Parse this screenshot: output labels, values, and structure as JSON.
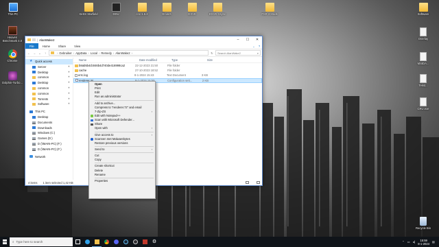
{
  "colors": {
    "accent": "#1979ca",
    "selection": "#cce8ff",
    "taskbar": "#101419",
    "menu_bg": "#f0f0f0"
  },
  "desktop": {
    "top_icons": [
      {
        "label": "This PC",
        "icon": "this-pc-icon"
      },
      {
        "label": "XeSS Starfield",
        "icon": "folder-icon"
      },
      {
        "label": "DDU",
        "icon": "app-icon"
      },
      {
        "label": "cnc-1.5.2",
        "icon": "folder-icon"
      },
      {
        "label": "Drivers",
        "icon": "folder-icon"
      },
      {
        "label": "DXVK",
        "icon": "folder-icon"
      },
      {
        "label": "DXVK-Async",
        "icon": "folder-icon"
      },
      {
        "label": "FSR 3 Mods",
        "icon": "folder-icon"
      },
      {
        "label": "Software",
        "icon": "folder-icon"
      }
    ],
    "left_icons": [
      {
        "label": "Heaven Benchmark 4.0",
        "icon": "game-icon"
      },
      {
        "label": "Chrome",
        "icon": "chrome-icon"
      },
      {
        "label": "Dolphin-Turbo...",
        "icon": "app-icon"
      }
    ],
    "right_icons": [
      {
        "label": "Overlay",
        "icon": "document-icon"
      },
      {
        "label": "MSIDA...",
        "icon": "document-icon"
      },
      {
        "label": "Tekst...",
        "icon": "document-icon"
      },
      {
        "label": "CRU.exe",
        "icon": "document-icon"
      },
      {
        "label": "Recycle Bin",
        "icon": "recycle-bin-icon"
      }
    ]
  },
  "explorer": {
    "title": "AlanWake2",
    "ribbon_tabs": [
      "File",
      "Home",
      "Share",
      "View"
    ],
    "breadcrumb": [
      "Gebruiker",
      "AppData",
      "Local",
      "Remedy",
      "AlanWake2"
    ],
    "search_placeholder": "Search AlanWake2",
    "nav": {
      "quick_access": "Quick access",
      "pinned": [
        "Server",
        "Desktop",
        "common",
        "Desktop",
        "common",
        "common",
        "Torrents",
        "Software"
      ],
      "this_pc": "This PC",
      "pc_items": [
        "Desktop",
        "Documents",
        "Downloads",
        "Windows (C:)",
        "Games (D:)",
        "D (\\\\MAIN-PC) (F:)",
        "D (\\\\MAIN-PC) (F:)"
      ],
      "network": "Network"
    },
    "columns": {
      "name": "Name",
      "date": "Date modified",
      "type": "Type",
      "size": "Size"
    },
    "files": [
      {
        "name": "b8ab5b4cb046b4d740de416998ca2",
        "date": "22-12-2023 21:50",
        "type": "File folder",
        "size": "",
        "icon": "folder"
      },
      {
        "name": "cache",
        "date": "27-10-2023 18:52",
        "type": "File folder",
        "size": "",
        "icon": "folder"
      },
      {
        "name": "errc.log",
        "date": "8-1-2024 15:43",
        "type": "Text Document",
        "size": "3 KB",
        "icon": "txt"
      },
      {
        "name": "renderer.ini",
        "date": "8-1-2024 15:59",
        "type": "Configuration sett...",
        "size": "2 KB",
        "icon": "ini"
      }
    ],
    "status": {
      "items": "4 items",
      "selected": "1 item selected  1,42 KB"
    }
  },
  "context_menu": {
    "items": [
      {
        "label": "Open",
        "bold": true
      },
      {
        "label": "Print"
      },
      {
        "label": "Edit"
      },
      {
        "label": "Run as administrator"
      },
      {
        "sep": true
      },
      {
        "label": "Add to archive..."
      },
      {
        "label": "Compress to \"renderer.7z\" and email"
      },
      {
        "label": "7-Zip-ZS",
        "arrow": true
      },
      {
        "label": "Edit with Notepad++",
        "icon": "npp"
      },
      {
        "label": "Scan with Microsoft Defender...",
        "icon": "def"
      },
      {
        "label": "Share",
        "icon": "share"
      },
      {
        "label": "Open with",
        "arrow": true
      },
      {
        "sep": true
      },
      {
        "label": "Give access to",
        "arrow": true
      },
      {
        "label": "Scannen met Malwarebytes",
        "icon": "mbytes"
      },
      {
        "label": "Restore previous versions"
      },
      {
        "sep": true
      },
      {
        "label": "Send to",
        "arrow": true
      },
      {
        "sep": true
      },
      {
        "label": "Cut"
      },
      {
        "label": "Copy"
      },
      {
        "sep": true
      },
      {
        "label": "Create shortcut"
      },
      {
        "label": "Delete"
      },
      {
        "label": "Rename"
      },
      {
        "sep": true
      },
      {
        "label": "Properties"
      }
    ]
  },
  "taskbar": {
    "search_placeholder": "Type here to search",
    "apps": [
      "task-view-icon",
      "edge-icon",
      "explorer-icon",
      "chrome-icon",
      "discord-icon",
      "steam-icon",
      "obs-icon",
      "app-icon",
      "settings-icon"
    ],
    "time": "15:59",
    "date": "8-1-2024"
  }
}
